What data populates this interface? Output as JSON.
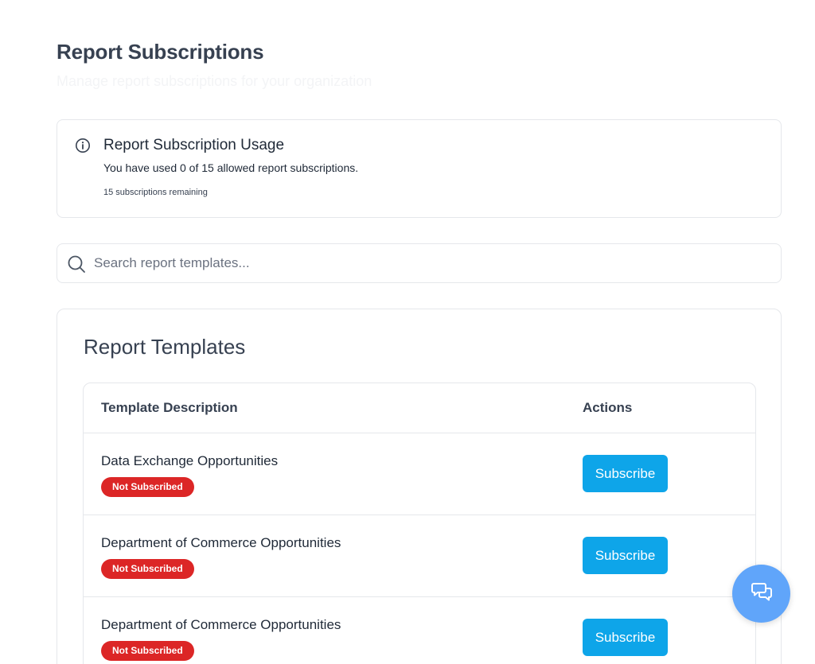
{
  "header": {
    "title": "Report Subscriptions",
    "subtitle": "Manage report subscriptions for your organization"
  },
  "usage": {
    "icon": "info-icon",
    "title": "Report Subscription Usage",
    "text": "You have used 0 of 15 allowed report subscriptions.",
    "remaining": "15 subscriptions remaining"
  },
  "search": {
    "icon": "search-icon",
    "placeholder": "Search report templates...",
    "value": ""
  },
  "templates": {
    "title": "Report Templates",
    "columns": {
      "description": "Template Description",
      "actions": "Actions"
    },
    "rows": [
      {
        "name": "Data Exchange Opportunities",
        "status": "Not Subscribed",
        "action": "Subscribe"
      },
      {
        "name": "Department of Commerce Opportunities",
        "status": "Not Subscribed",
        "action": "Subscribe"
      },
      {
        "name": "Department of Commerce Opportunities",
        "status": "Not Subscribed",
        "action": "Subscribe"
      }
    ]
  },
  "chat": {
    "icon": "chat-icon"
  },
  "colors": {
    "badge": "#dc2626",
    "button": "#0ea5e9",
    "fab": "#60a5fa"
  }
}
